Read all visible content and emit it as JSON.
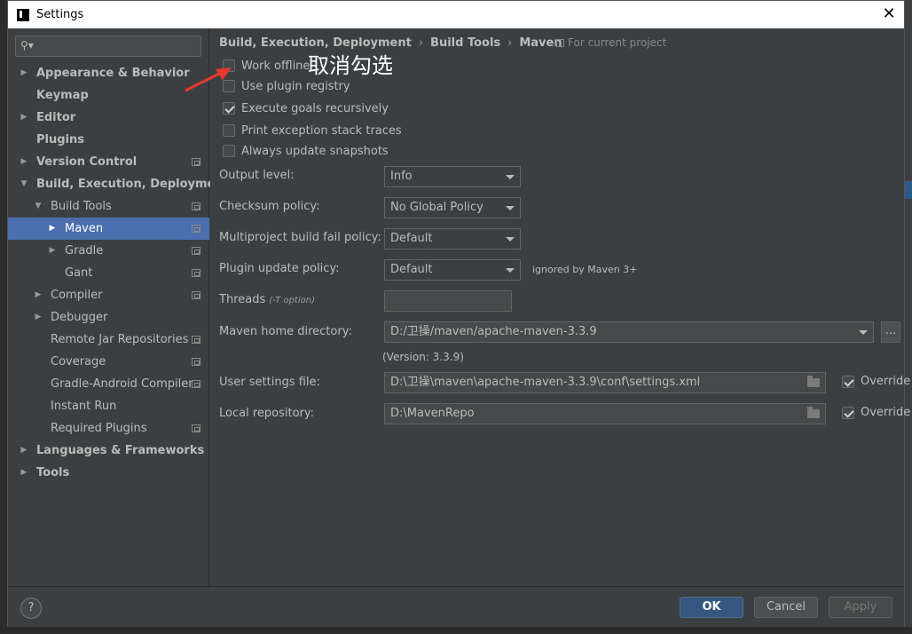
{
  "window": {
    "title": "Settings",
    "close": "✕"
  },
  "search": {
    "placeholder": ""
  },
  "tree": [
    {
      "label": "Appearance & Behavior",
      "level": 0,
      "arrow": "▶",
      "bold": true,
      "proj": false
    },
    {
      "label": "Keymap",
      "level": 0,
      "arrow": "",
      "bold": true,
      "proj": false
    },
    {
      "label": "Editor",
      "level": 0,
      "arrow": "▶",
      "bold": true,
      "proj": false
    },
    {
      "label": "Plugins",
      "level": 0,
      "arrow": "",
      "bold": true,
      "proj": false
    },
    {
      "label": "Version Control",
      "level": 0,
      "arrow": "▶",
      "bold": true,
      "proj": true
    },
    {
      "label": "Build, Execution, Deployment",
      "level": 0,
      "arrow": "▼",
      "bold": true,
      "proj": false
    },
    {
      "label": "Build Tools",
      "level": 1,
      "arrow": "▼",
      "bold": false,
      "proj": true
    },
    {
      "label": "Maven",
      "level": 2,
      "arrow": "▶",
      "bold": false,
      "proj": true,
      "selected": true
    },
    {
      "label": "Gradle",
      "level": 2,
      "arrow": "▶",
      "bold": false,
      "proj": true
    },
    {
      "label": "Gant",
      "level": 2,
      "arrow": "",
      "bold": false,
      "proj": true
    },
    {
      "label": "Compiler",
      "level": 1,
      "arrow": "▶",
      "bold": false,
      "proj": true
    },
    {
      "label": "Debugger",
      "level": 1,
      "arrow": "▶",
      "bold": false,
      "proj": false
    },
    {
      "label": "Remote Jar Repositories",
      "level": 1,
      "arrow": "",
      "bold": false,
      "proj": true
    },
    {
      "label": "Coverage",
      "level": 1,
      "arrow": "",
      "bold": false,
      "proj": true
    },
    {
      "label": "Gradle-Android Compiler",
      "level": 1,
      "arrow": "",
      "bold": false,
      "proj": true
    },
    {
      "label": "Instant Run",
      "level": 1,
      "arrow": "",
      "bold": false,
      "proj": false
    },
    {
      "label": "Required Plugins",
      "level": 1,
      "arrow": "",
      "bold": false,
      "proj": true
    },
    {
      "label": "Languages & Frameworks",
      "level": 0,
      "arrow": "▶",
      "bold": true,
      "proj": false
    },
    {
      "label": "Tools",
      "level": 0,
      "arrow": "▶",
      "bold": true,
      "proj": false
    }
  ],
  "breadcrumb": {
    "items": [
      "Build, Execution, Deployment",
      "Build Tools",
      "Maven"
    ],
    "separator": "›"
  },
  "for_project": "For current project",
  "annotation": "取消勾选",
  "checkboxes": [
    {
      "label": "Work offline",
      "checked": false
    },
    {
      "label": "Use plugin registry",
      "checked": false
    },
    {
      "label": "Execute goals recursively",
      "checked": true
    },
    {
      "label": "Print exception stack traces",
      "checked": false
    },
    {
      "label": "Always update snapshots",
      "checked": false
    }
  ],
  "form": {
    "output_level": {
      "label": "Output level:",
      "value": "Info"
    },
    "checksum_policy": {
      "label": "Checksum policy:",
      "value": "No Global Policy"
    },
    "multiproject_fail": {
      "label": "Multiproject build fail policy:",
      "value": "Default"
    },
    "plugin_update": {
      "label": "Plugin update policy:",
      "value": "Default",
      "note": "ignored by Maven 3+"
    },
    "threads": {
      "label": "Threads",
      "hint": "(-T option)",
      "value": ""
    },
    "maven_home": {
      "label": "Maven home directory:",
      "value": "D:/卫操/maven/apache-maven-3.3.9",
      "dots": "...",
      "version": "(Version: 3.3.9)"
    },
    "user_settings": {
      "label": "User settings file:",
      "value": "D:\\卫操\\maven\\apache-maven-3.3.9\\conf\\settings.xml",
      "override_label": "Override",
      "override": true
    },
    "local_repo": {
      "label": "Local repository:",
      "value": "D:\\MavenRepo",
      "override_label": "Override",
      "override": true
    }
  },
  "footer": {
    "help": "?",
    "ok": "OK",
    "cancel": "Cancel",
    "apply": "Apply"
  },
  "colors": {
    "selection": "#4b6eaf",
    "ok_button": "#365880",
    "annotation_arrow": "#e8392f"
  }
}
